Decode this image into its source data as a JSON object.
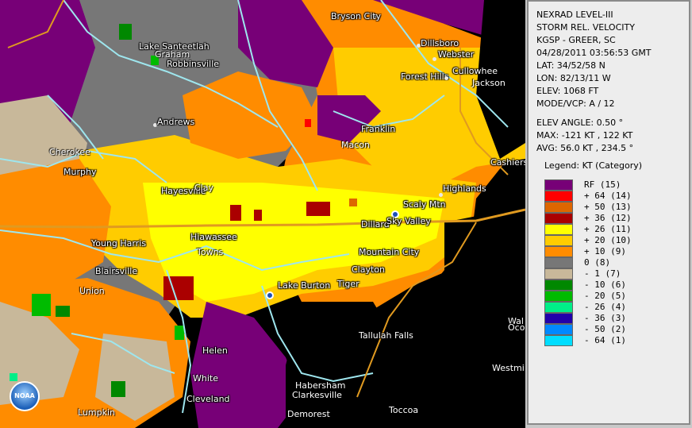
{
  "panel": {
    "line1": "NEXRAD LEVEL-III",
    "line2": "STORM REL. VELOCITY",
    "line3": "KGSP - GREER, SC",
    "line4": "04/28/2011 03:56:53 GMT",
    "line5": "LAT: 34/52/58 N",
    "line6": "LON: 82/13/11 W",
    "line7": "ELEV: 1068 FT",
    "line8": "MODE/VCP: A / 12",
    "line9": "ELEV ANGLE: 0.50 °",
    "line10": "MAX: -121 KT , 122 KT",
    "line11": "AVG: 56.0 KT , 234.5 °",
    "legend_title": "Legend: KT (Category)"
  },
  "legend": [
    {
      "label": "RF  (15)",
      "color": "#770077"
    },
    {
      "label": "+ 64  (14)",
      "color": "#ff0000"
    },
    {
      "label": "+ 50  (13)",
      "color": "#dd6600"
    },
    {
      "label": "+ 36  (12)",
      "color": "#aa0000"
    },
    {
      "label": "+ 26  (11)",
      "color": "#ffff00"
    },
    {
      "label": "+ 20  (10)",
      "color": "#ffcc00"
    },
    {
      "label": "+ 10  (9)",
      "color": "#ff8c00"
    },
    {
      "label": "0  (8)",
      "color": "#777777"
    },
    {
      "label": "- 1  (7)",
      "color": "#c8b89a"
    },
    {
      "label": "- 10  (6)",
      "color": "#008800"
    },
    {
      "label": "- 20  (5)",
      "color": "#00bb00"
    },
    {
      "label": "- 26  (4)",
      "color": "#00ee88"
    },
    {
      "label": "- 36  (3)",
      "color": "#2200aa"
    },
    {
      "label": "- 50  (2)",
      "color": "#0088ff"
    },
    {
      "label": "- 64  (1)",
      "color": "#00ddff"
    }
  ],
  "places": {
    "bryson_city": "Bryson City",
    "dillsboro": "Dillsboro",
    "webster": "Webster",
    "forest_hills": "Forest Hills",
    "cullowhee": "Cullowhee",
    "jackson": "Jackson",
    "lake_santeetlah": "Lake Santeetlah",
    "graham": "Graham",
    "robbinsville": "Robbinsville",
    "andrews": "Andrews",
    "franklin": "Franklin",
    "macon": "Macon",
    "cherokee": "Cherokee",
    "murphy": "Murphy",
    "cashiers": "Cashiers",
    "hayesville": "Hayesville",
    "clay": "Clay",
    "highlands": "Highlands",
    "scaly_mtn": "Scaly Mtn",
    "dillard": "Dillard",
    "sky_valley": "Sky Valley",
    "young_harris": "Young Harris",
    "hiawassee": "Hiawassee",
    "towns": "Towns",
    "mountain_city": "Mountain City",
    "clayton": "Clayton",
    "blairsville": "Blairsville",
    "lake_burton": "Lake Burton",
    "tiger": "Tiger",
    "union": "Union",
    "tallulah_falls": "Tallulah Falls",
    "helen": "Helen",
    "white": "White",
    "westmi": "Westmi",
    "habersham": "Habersham",
    "clarkesville": "Clarkesville",
    "cleveland": "Cleveland",
    "lumpkin": "Lumpkin",
    "demorest": "Demorest",
    "toccoa": "Toccoa",
    "wal": "Wal",
    "oco": "Oco"
  },
  "logo_text": "NOAA"
}
